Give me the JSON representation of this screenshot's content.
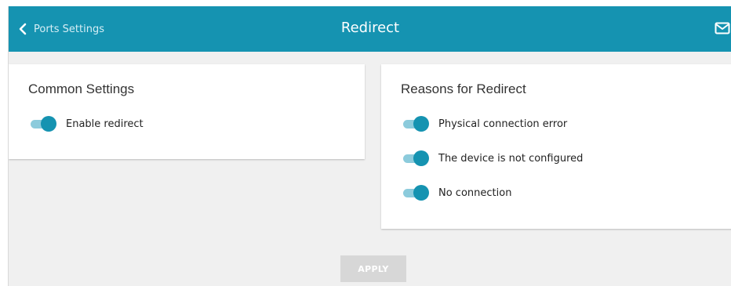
{
  "header": {
    "back_label": "Ports Settings",
    "title": "Redirect",
    "mail_icon": "envelope-icon",
    "back_icon": "chevron-left-icon"
  },
  "common_settings": {
    "title": "Common Settings",
    "toggles": [
      {
        "label": "Enable redirect",
        "on": true
      }
    ]
  },
  "reasons": {
    "title": "Reasons for Redirect",
    "toggles": [
      {
        "label": "Physical connection error",
        "on": true
      },
      {
        "label": "The device is not configured",
        "on": true
      },
      {
        "label": "No connection",
        "on": true
      }
    ]
  },
  "apply_label": "APPLY",
  "colors": {
    "accent": "#1593b1",
    "toggle_track": "#8ccbdc",
    "background": "#f0f0f0",
    "apply_disabled": "#d7d7d7"
  }
}
